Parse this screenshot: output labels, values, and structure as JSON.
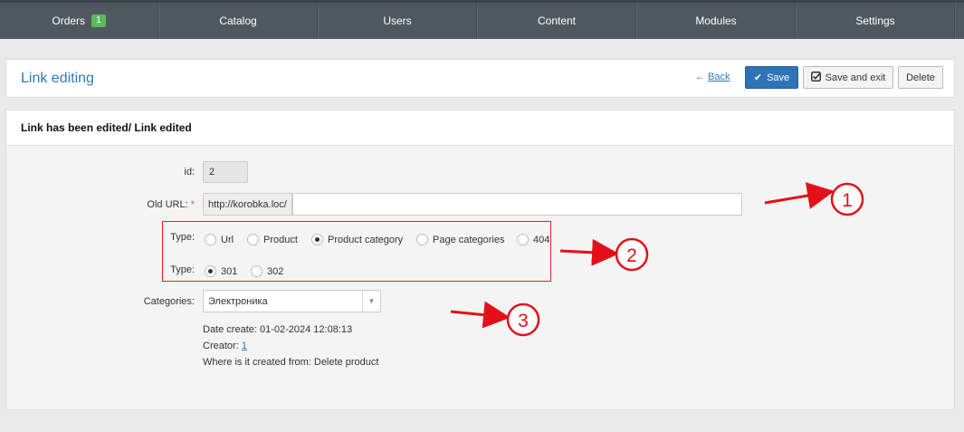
{
  "nav": {
    "items": [
      {
        "label": "Orders",
        "badge": "1"
      },
      {
        "label": "Catalog"
      },
      {
        "label": "Users"
      },
      {
        "label": "Content"
      },
      {
        "label": "Modules"
      },
      {
        "label": "Settings"
      }
    ]
  },
  "header": {
    "title": "Link editing",
    "back_label": "Back",
    "save_label": "Save",
    "save_exit_label": "Save and exit",
    "delete_label": "Delete"
  },
  "form": {
    "heading": "Link has been edited/ Link edited",
    "id_label": "id:",
    "id_value": "2",
    "old_url_label": "Old URL:",
    "required_mark": "*",
    "url_prefix": "http://korobka.loc/",
    "url_value": "",
    "type1_label": "Type:",
    "type1_options": [
      {
        "label": "Url",
        "selected": false
      },
      {
        "label": "Product",
        "selected": false
      },
      {
        "label": "Product category",
        "selected": true
      },
      {
        "label": "Page categories",
        "selected": false
      },
      {
        "label": "404",
        "selected": false
      }
    ],
    "type2_label": "Type:",
    "type2_options": [
      {
        "label": "301",
        "selected": true
      },
      {
        "label": "302",
        "selected": false
      }
    ],
    "categories_label": "Categories:",
    "categories_value": "Электроника",
    "date_create": "Date create: 01-02-2024 12:08:13",
    "creator_label": "Creator:",
    "creator_value": "1",
    "created_from": "Where is it created from: Delete product"
  },
  "annotations": [
    "1",
    "2",
    "3"
  ],
  "colors": {
    "nav_bg": "#50585f",
    "accent": "#2b7bb9",
    "badge": "#5cb85c",
    "annotation": "#e3101a"
  }
}
